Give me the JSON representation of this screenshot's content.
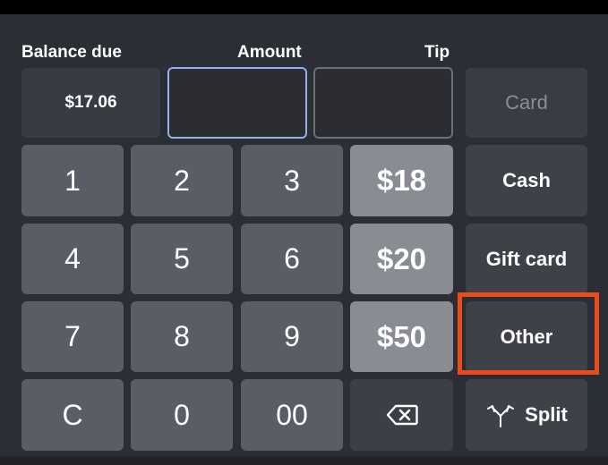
{
  "labels": {
    "balance_due": "Balance due",
    "amount": "Amount",
    "tip": "Tip"
  },
  "balance": {
    "value": "$17.06"
  },
  "inputs": {
    "amount_value": "",
    "tip_value": ""
  },
  "keypad": {
    "k1": "1",
    "k2": "2",
    "k3": "3",
    "k4": "4",
    "k5": "5",
    "k6": "6",
    "k7": "7",
    "k8": "8",
    "k9": "9",
    "clear": "C",
    "k0": "0",
    "k00": "00",
    "quick_18": "$18",
    "quick_20": "$20",
    "quick_50": "$50"
  },
  "payment_methods": {
    "card": "Card",
    "cash": "Cash",
    "gift_card": "Gift card",
    "other": "Other",
    "split": "Split"
  },
  "icons": {
    "backspace": "backspace-icon",
    "split": "split-arrows-icon"
  },
  "colors": {
    "panel": "#2c2e35",
    "key": "#5b5d66",
    "quick_key": "#8a8c94",
    "amount_border": "#8fb2ea",
    "highlight": "#ee4b1b"
  }
}
